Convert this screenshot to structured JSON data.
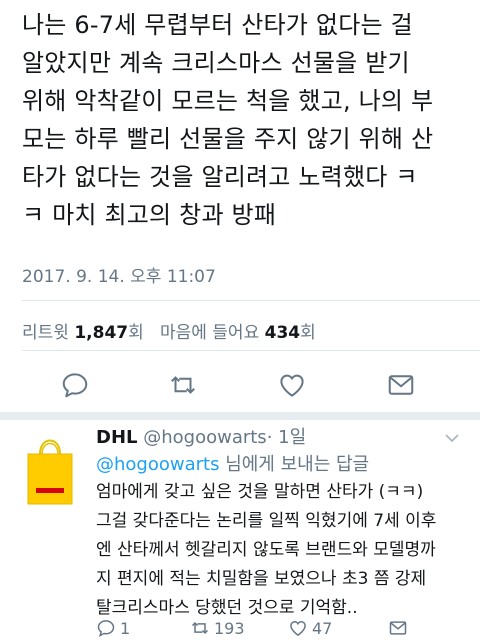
{
  "tweet": {
    "text": "나는 6-7세 무렵부터 산타가 없다는 걸\n알았지만 계속 크리스마스 선물을 받기\n위해 악착같이 모르는 척을 했고, 나의 부\n모는 하루 빨리 선물을 주지 않기 위해 산\n타가 없다는 것을 알리려고 노력했다 ㅋ\nㅋ 마치 최고의 창과 방패",
    "timestamp": "2017. 9. 14. 오후 11:07",
    "retweet_label": "리트윗",
    "retweet_count": "1,847",
    "retweet_unit": "회",
    "like_label": "마음에 들어요",
    "like_count": "434",
    "like_unit": "회"
  },
  "actions": {
    "icons": [
      "reply-icon",
      "retweet-icon",
      "like-icon",
      "share-icon"
    ]
  },
  "reply": {
    "name": "DHL",
    "handle": "@hogoowarts",
    "time": "· 1일",
    "replying_mention": "@hogoowarts",
    "replying_suffix": " 님에게 보내는 답글",
    "text": "엄마에게 갖고 싶은 것을 말하면 산타가 (ㅋㅋ)\n그걸 갖다준다는 논리를 일찍 익혔기에 7세 이후\n엔 산타께서 헷갈리지 않도록 브랜드와 모델명까\n지 편지에 적는 치밀함을 보였으나 초3 쯤 강제\n탈크리스마스 당했던 것으로 기억함..",
    "reply_count": "1",
    "retweet_count": "193",
    "like_count": "47"
  },
  "colors": {
    "accent": "#1da1f2",
    "secondary_text": "#657786",
    "dhl_yellow": "#ffcc00",
    "dhl_red": "#d40511"
  }
}
